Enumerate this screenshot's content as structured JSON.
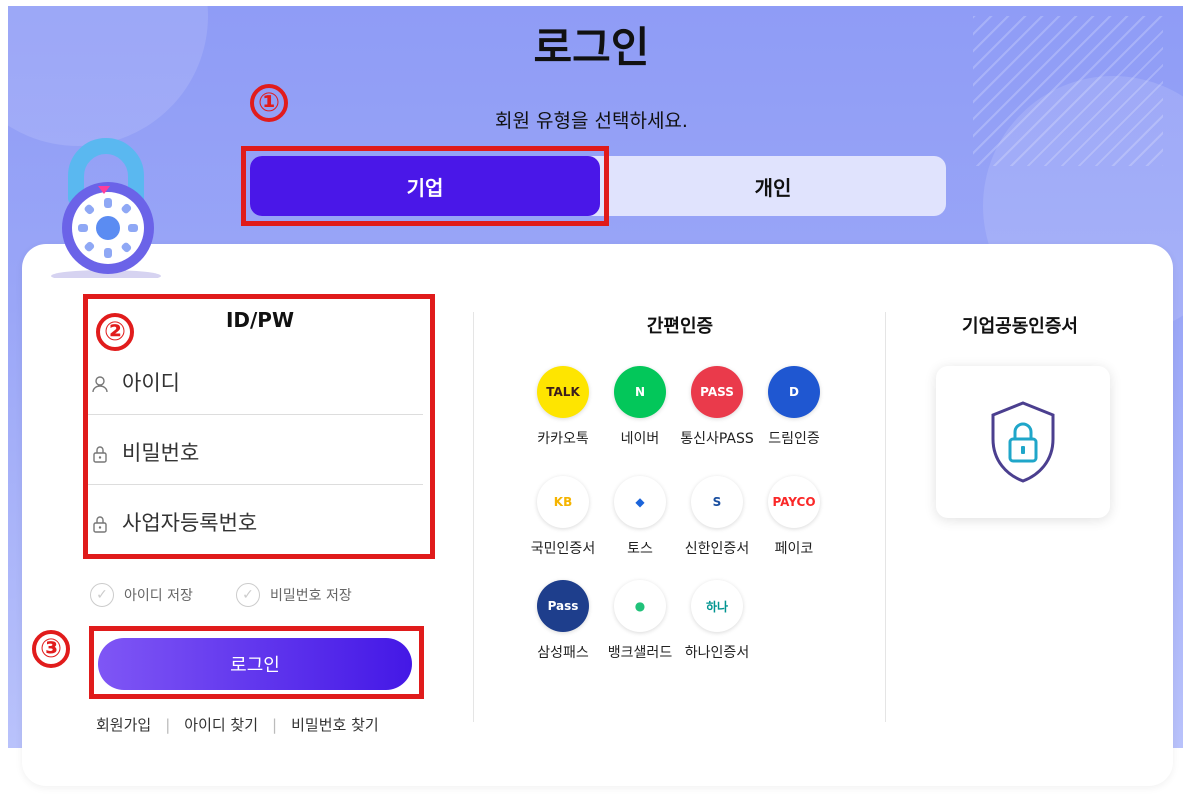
{
  "header": {
    "title": "로그인",
    "subtitle": "회원 유형을 선택하세요."
  },
  "steps": [
    "①",
    "②",
    "③"
  ],
  "tabs": {
    "corporate": "기업",
    "personal": "개인"
  },
  "idpw": {
    "title": "ID/PW",
    "id_placeholder": "아이디",
    "password_placeholder": "비밀번호",
    "business_number_placeholder": "사업자등록번호",
    "save_id": "아이디 저장",
    "save_password": "비밀번호 저장",
    "login_button": "로그인",
    "links": [
      "회원가입",
      "아이디 찾기",
      "비밀번호 찾기"
    ]
  },
  "simple_auth": {
    "title": "간편인증",
    "providers": [
      {
        "label": "카카오톡",
        "logo_text": "TALK",
        "bg": "#fee500",
        "fg": "#3c1e1e"
      },
      {
        "label": "네이버",
        "logo_text": "N",
        "bg": "#03c75a",
        "fg": "#ffffff"
      },
      {
        "label": "통신사PASS",
        "logo_text": "PASS",
        "bg": "#ea3a4b",
        "fg": "#ffffff"
      },
      {
        "label": "드림인증",
        "logo_text": "D",
        "bg": "#1f57d1",
        "fg": "#ffffff"
      },
      {
        "label": "국민인증서",
        "logo_text": "KB",
        "bg": "#ffffff",
        "fg": "#f5b400"
      },
      {
        "label": "토스",
        "logo_text": "◆",
        "bg": "#ffffff",
        "fg": "#1b64da"
      },
      {
        "label": "신한인증서",
        "logo_text": "S",
        "bg": "#ffffff",
        "fg": "#1a4fa0"
      },
      {
        "label": "페이코",
        "logo_text": "PAYCO",
        "bg": "#ffffff",
        "fg": "#fa2828"
      },
      {
        "label": "삼성패스",
        "logo_text": "Pass",
        "bg": "#1e3e8c",
        "fg": "#ffffff"
      },
      {
        "label": "뱅크샐러드",
        "logo_text": "●",
        "bg": "#ffffff",
        "fg": "#21c27a"
      },
      {
        "label": "하나인증서",
        "logo_text": "하나",
        "bg": "#ffffff",
        "fg": "#009490"
      }
    ]
  },
  "corp_cert": {
    "title": "기업공동인증서"
  },
  "colors": {
    "primary": "#4a17e8",
    "highlight": "#e01b1b",
    "hero_bg": "#9aa6f7"
  }
}
